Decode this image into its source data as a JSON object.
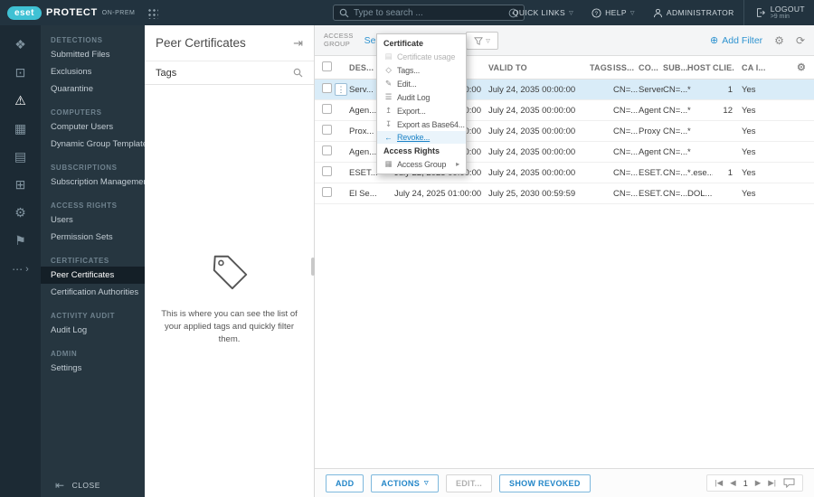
{
  "topbar": {
    "brand_eset": "eset",
    "brand_product": "PROTECT",
    "brand_edition": "ON-PREM",
    "search_placeholder": "Type to search ...",
    "quick_links_label": "QUICK LINKS",
    "help_label": "HELP",
    "user_label": "ADMINISTRATOR",
    "logout_label": "LOGOUT",
    "logout_timer": ">9 min"
  },
  "sidebar": {
    "sections": [
      {
        "title": "DETECTIONS",
        "items": [
          "Submitted Files",
          "Exclusions",
          "Quarantine"
        ]
      },
      {
        "title": "COMPUTERS",
        "items": [
          "Computer Users",
          "Dynamic Group Templates"
        ]
      },
      {
        "title": "SUBSCRIPTIONS",
        "items": [
          "Subscription Management"
        ]
      },
      {
        "title": "ACCESS RIGHTS",
        "items": [
          "Users",
          "Permission Sets"
        ]
      },
      {
        "title": "CERTIFICATES",
        "items": [
          "Peer Certificates",
          "Certification Authorities"
        ]
      },
      {
        "title": "ACTIVITY AUDIT",
        "items": [
          "Audit Log"
        ]
      },
      {
        "title": "ADMIN",
        "items": [
          "Settings"
        ]
      }
    ],
    "close_label": "CLOSE"
  },
  "panel": {
    "title": "Peer Certificates",
    "tags_label": "Tags",
    "empty_text": "This is where you can see the list of your applied tags and quickly filter them."
  },
  "toolbar": {
    "access_group_line1": "ACCESS",
    "access_group_line2": "GROUP",
    "select_label": "Select",
    "add_filter_label": "Add Filter"
  },
  "table": {
    "headers": {
      "des": "DES...",
      "valid_from": "",
      "valid_to": "VALID TO",
      "tags": "TAGS",
      "iss": "ISS...",
      "co": "CO...",
      "sub": "SUB...",
      "host": "HOST",
      "clie": "CLIE...",
      "ca": "CA I..."
    },
    "rows": [
      {
        "des": "Serv...",
        "valid_from": "00:00:00",
        "valid_to": "July 24, 2035 00:00:00",
        "tags": "",
        "iss": "CN=...",
        "co": "Server",
        "sub": "CN=...",
        "host": "*",
        "clie": "1",
        "ca": "Yes"
      },
      {
        "des": "Agen...",
        "valid_from": "00:00:00",
        "valid_to": "July 24, 2035 00:00:00",
        "tags": "",
        "iss": "CN=...",
        "co": "Agent",
        "sub": "CN=...",
        "host": "*",
        "clie": "12",
        "ca": "Yes"
      },
      {
        "des": "Prox...",
        "valid_from": "00:00:00",
        "valid_to": "July 24, 2035 00:00:00",
        "tags": "",
        "iss": "CN=...",
        "co": "Proxy",
        "sub": "CN=...",
        "host": "*",
        "clie": "",
        "ca": "Yes"
      },
      {
        "des": "Agen...",
        "valid_from": "00:00:00",
        "valid_to": "July 24, 2035 00:00:00",
        "tags": "",
        "iss": "CN=...",
        "co": "Agent",
        "sub": "CN=...",
        "host": "*",
        "clie": "",
        "ca": "Yes"
      },
      {
        "des": "ESET...",
        "valid_from": "July 22, 2025 00:00:00",
        "valid_to": "July 24, 2035 00:00:00",
        "tags": "",
        "iss": "CN=...",
        "co": "ESET...",
        "sub": "CN=...",
        "host": "*.ese...",
        "clie": "1",
        "ca": "Yes"
      },
      {
        "des": "El Se...",
        "valid_from": "July 24, 2025 01:00:00",
        "valid_to": "July 25, 2030 00:59:59",
        "tags": "",
        "iss": "CN=...",
        "co": "ESET...",
        "sub": "CN=...",
        "host": "DOL...",
        "clie": "",
        "ca": "Yes"
      }
    ]
  },
  "context_menu": {
    "sections": [
      {
        "title": "Certificate",
        "items": [
          {
            "label": "Certificate usage"
          },
          {
            "label": "Tags..."
          },
          {
            "label": "Edit..."
          },
          {
            "label": "Audit Log"
          },
          {
            "label": "Export..."
          },
          {
            "label": "Export as Base64..."
          },
          {
            "label": "Revoke..."
          }
        ]
      },
      {
        "title": "Access Rights",
        "items": [
          {
            "label": "Access Group"
          }
        ]
      }
    ]
  },
  "footer": {
    "add_label": "ADD",
    "actions_label": "ACTIONS",
    "edit_label": "EDIT...",
    "show_revoked_label": "SHOW REVOKED",
    "page": "1"
  },
  "icons": {
    "caret_down": "▽",
    "dashboard": "❖",
    "computers": "⊡",
    "detections": "⚠",
    "reports": "▦",
    "tasks": "▤",
    "installers": "⊞",
    "policies": "⚙",
    "notifications": "⚑",
    "more": "⋯",
    "chevron_right": "›",
    "cert_usage": "▤",
    "tags": "◇",
    "edit": "✎",
    "audit_log": "☰",
    "export": "↥",
    "export_b64": "↧",
    "revoke": "←",
    "access_group": "▦",
    "submenu_arrow": "▸",
    "gear": "⚙",
    "refresh": "⟳",
    "add": "⊕",
    "row_menu": "⋮",
    "close": "⇤",
    "collapse_panel": "⇥",
    "pag_first": "|◀",
    "pag_prev": "◀",
    "pag_next": "▶",
    "pag_last": "▶|"
  }
}
